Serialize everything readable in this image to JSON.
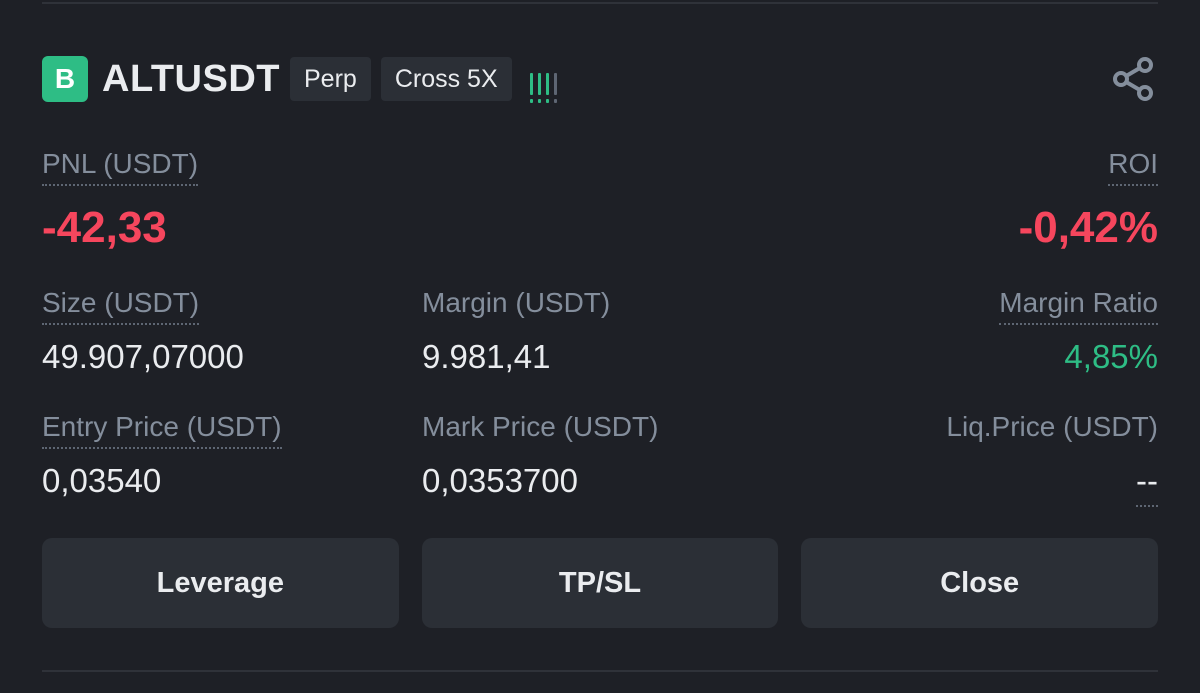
{
  "position": {
    "side_badge": "B",
    "symbol": "ALTUSDT",
    "tags": [
      "Perp",
      "Cross 5X"
    ],
    "signal_color": "#2ebd85",
    "signal_dim_color": "#5e6673",
    "signal_level": 3,
    "signal_bars": 4
  },
  "pnl": {
    "label": "PNL (USDT)",
    "value": "-42,33"
  },
  "roi": {
    "label": "ROI",
    "value": "-0,42%"
  },
  "size": {
    "label": "Size (USDT)",
    "value": "49.907,07000"
  },
  "margin": {
    "label": "Margin (USDT)",
    "value": "9.981,41"
  },
  "margin_ratio": {
    "label": "Margin Ratio",
    "value": "4,85%"
  },
  "entry_price": {
    "label": "Entry Price (USDT)",
    "value": "0,03540"
  },
  "mark_price": {
    "label": "Mark Price (USDT)",
    "value": "0,0353700"
  },
  "liq_price": {
    "label": "Liq.Price (USDT)",
    "value": "--"
  },
  "buttons": {
    "leverage": "Leverage",
    "tpsl": "TP/SL",
    "close": "Close"
  },
  "colors": {
    "background": "#1e2026",
    "negative": "#f6465d",
    "positive": "#2ebd85",
    "button_bg": "#2b2f36"
  }
}
